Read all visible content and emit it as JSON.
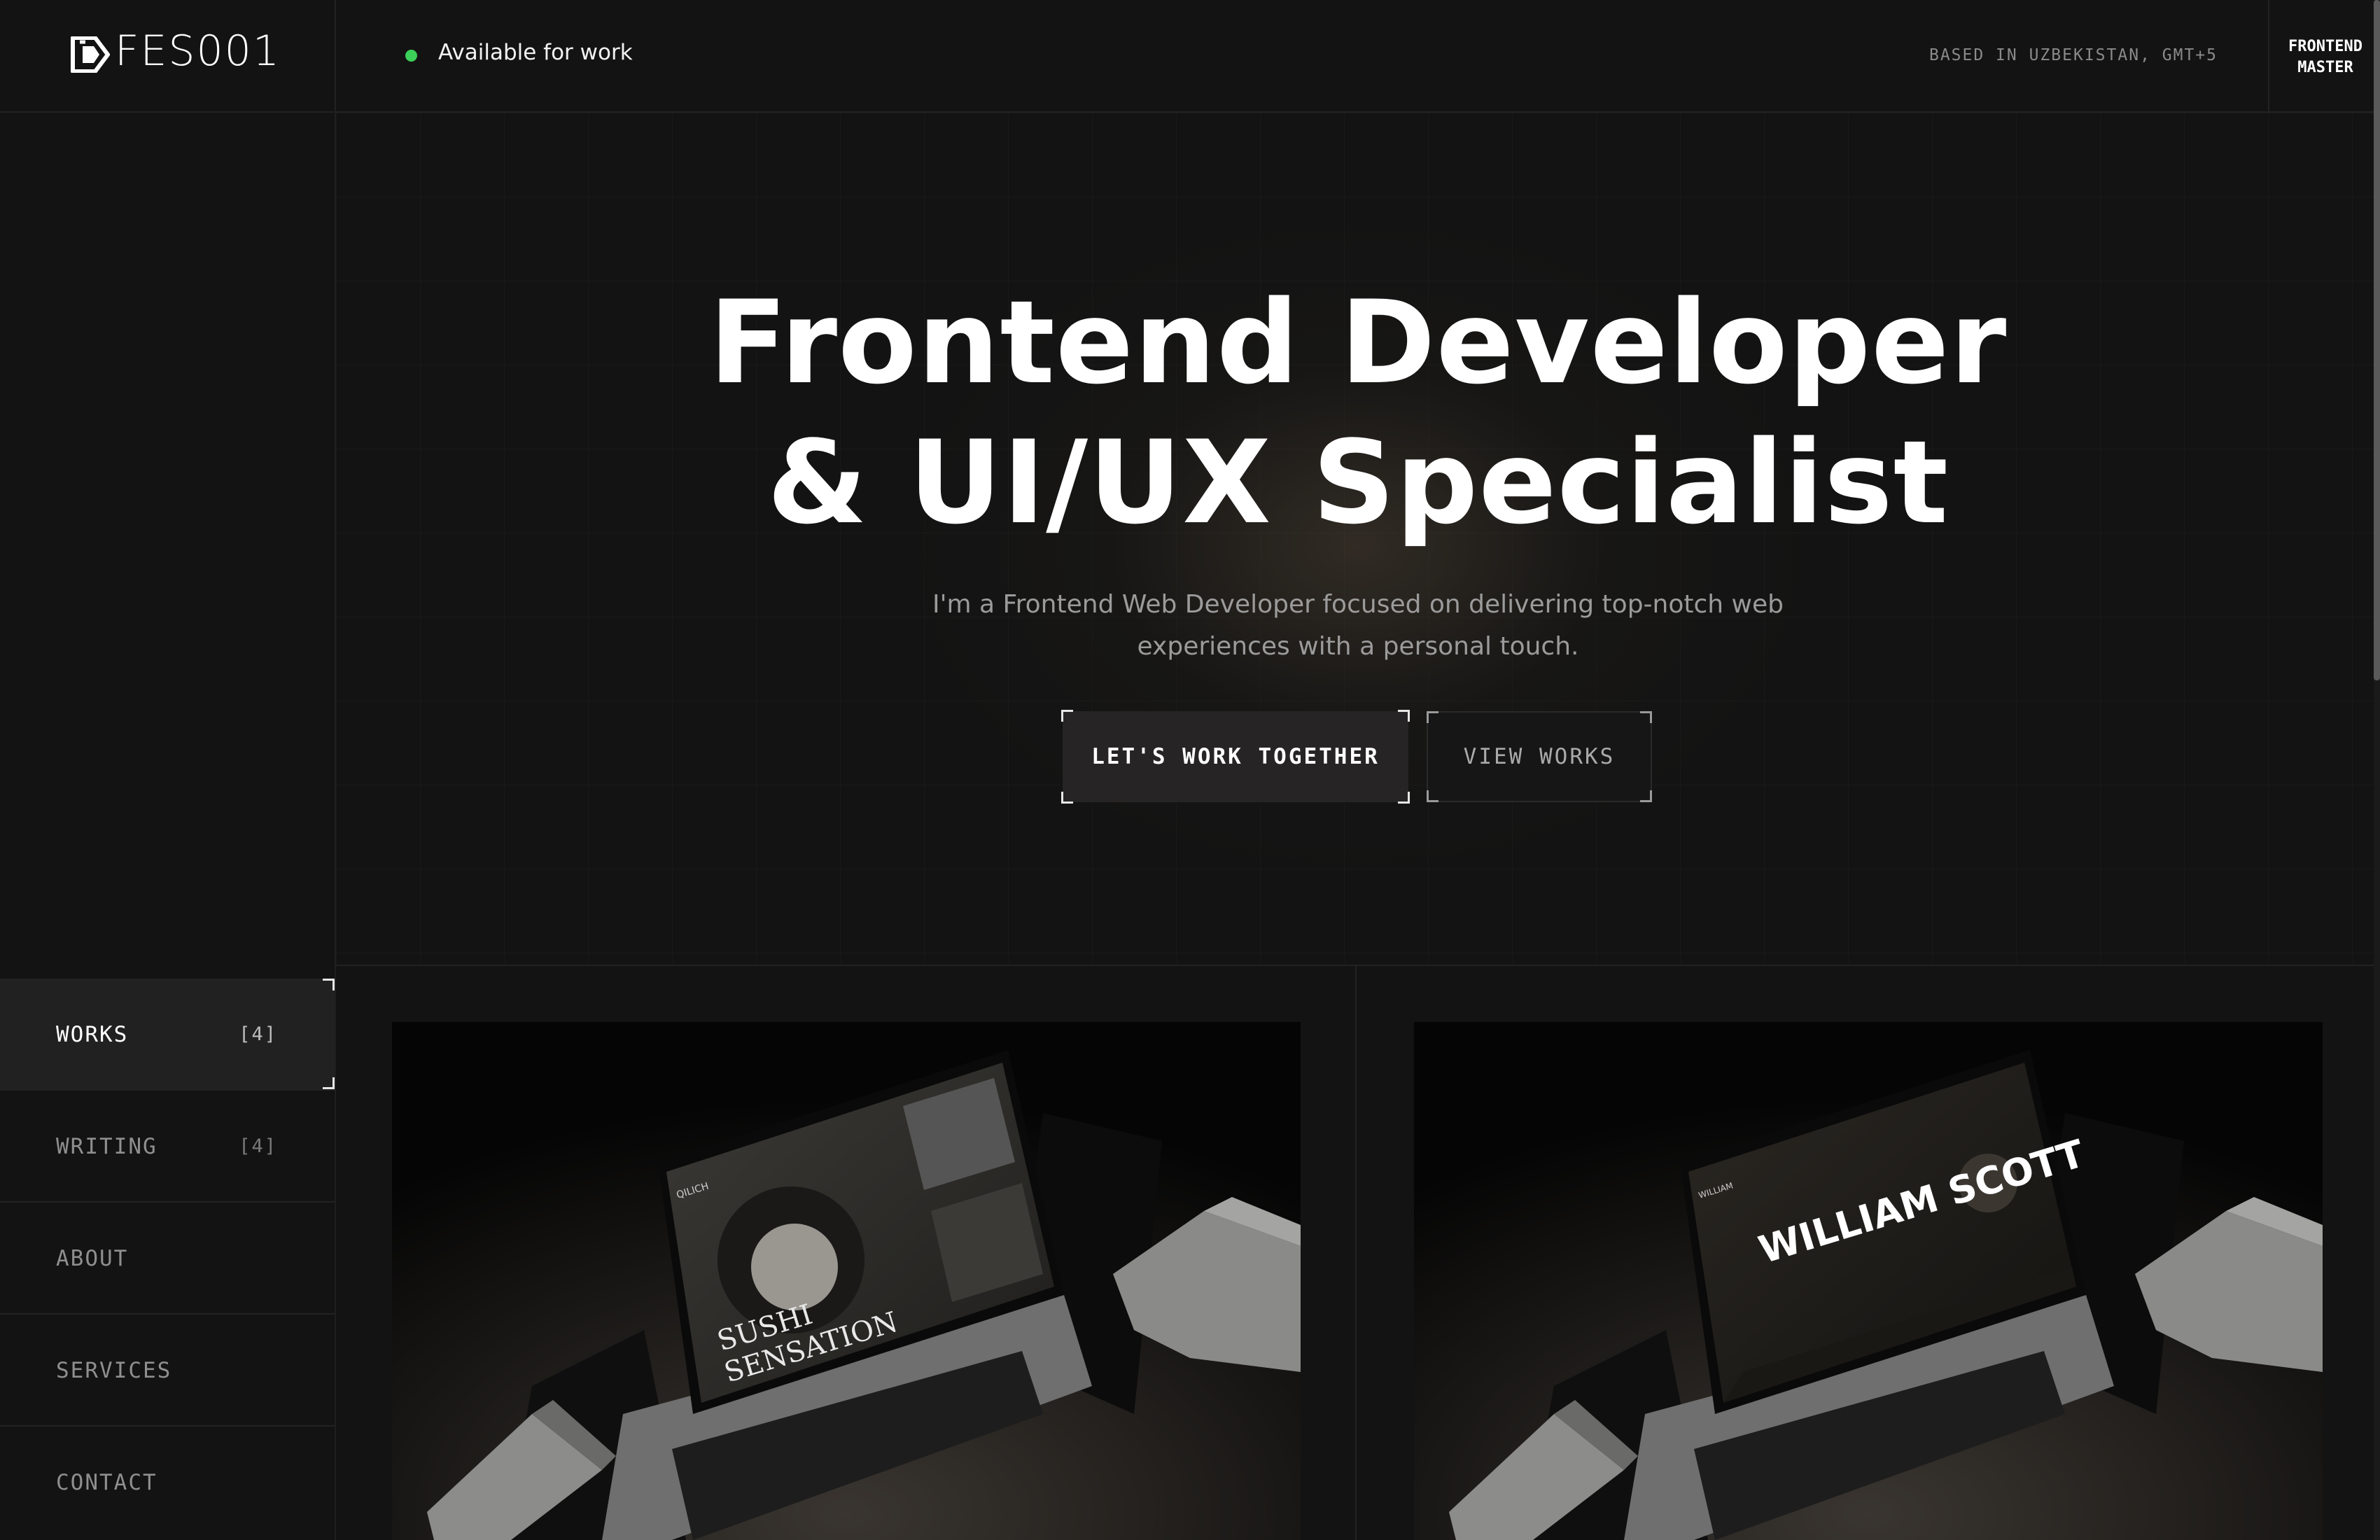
{
  "header": {
    "logo_text": "FES001",
    "availability": "Available for work",
    "location": "BASED IN UZBEKISTAN, GMT+5",
    "badge": "FRONTEND\nMASTER",
    "status_color": "#3cd05a"
  },
  "hero": {
    "title_line1": "Frontend Developer",
    "title_line2": "& UI/UX Specialist",
    "subtitle": "I'm a Frontend Web Developer focused on delivering top-notch web experiences with a personal touch.",
    "primary_button": "LET'S WORK TOGETHER",
    "secondary_button": "VIEW WORKS"
  },
  "nav": {
    "items": [
      {
        "label": "WORKS",
        "count": "[4]",
        "active": true
      },
      {
        "label": "WRITING",
        "count": "[4]",
        "active": false
      },
      {
        "label": "ABOUT",
        "count": "",
        "active": false
      },
      {
        "label": "SERVICES",
        "count": "",
        "active": false
      },
      {
        "label": "CONTACT",
        "count": "",
        "active": false
      }
    ]
  },
  "works": [
    {
      "screen_title": "SUSHI\nSENSATION",
      "screen_brand": "QILICH"
    },
    {
      "screen_title": "WILLIAM SCOTT",
      "screen_brand": "WILLIAM SCOTT"
    }
  ]
}
